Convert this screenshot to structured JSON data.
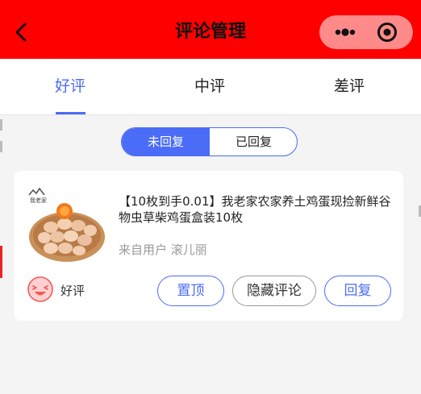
{
  "navbar": {
    "title": "评论管理",
    "bar_color": "#ff0000",
    "capsule_color": "#ff8a8a"
  },
  "tabs": [
    {
      "label": "好评",
      "active": true
    },
    {
      "label": "中评",
      "active": false
    },
    {
      "label": "差评",
      "active": false
    }
  ],
  "reply_filter": {
    "unreplied_label": "未回复",
    "replied_label": "已回复",
    "selected": "未回复"
  },
  "comment": {
    "product_title": "【10枚到手0.01】我老家农家养土鸡蛋现捡新鲜谷物虫草柴鸡蛋盒装10枚",
    "from_user": "来自用户 滚儿丽",
    "image_brand_text": "我老家",
    "rating_label": "好评",
    "rating_icon": "smile-face-icon",
    "actions": {
      "pin_label": "置顶",
      "hide_label": "隐藏评论",
      "reply_label": "回复"
    }
  },
  "colors": {
    "accent": "#4a6cf7",
    "page_bg": "#f4f4f4"
  }
}
